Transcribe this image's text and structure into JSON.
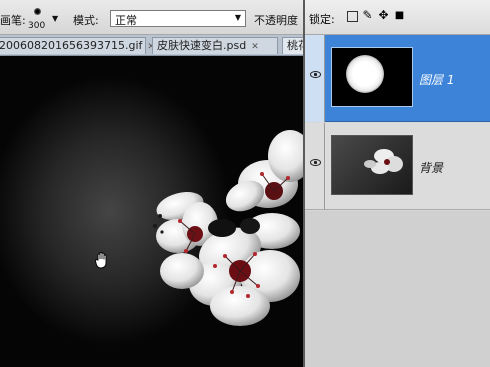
{
  "options_bar": {
    "brush_label": "画笔:",
    "brush_size": "300",
    "mode_label": "模式:",
    "mode_value": "正常",
    "opacity_label": "不透明度"
  },
  "tabs": [
    {
      "label": "20060820165639371​5.gif"
    },
    {
      "label": "皮肤快速变白.psd"
    },
    {
      "label": "桃花"
    }
  ],
  "layers_panel": {
    "lock_label": "锁定:",
    "layers": [
      {
        "name": "图层 1",
        "selected": true,
        "visible": true
      },
      {
        "name": "背景",
        "selected": false,
        "visible": true
      }
    ]
  },
  "colors": {
    "selected_layer": "#3d84d9",
    "panel_bg": "#d7d7d7",
    "canvas_edge": "#050505"
  },
  "icons": [
    "brush-tip-icon",
    "dropdown-arrow-icon",
    "hand-tool-icon",
    "eye-icon",
    "lock-transparent-icon",
    "lock-paint-icon",
    "lock-move-icon",
    "lock-all-icon"
  ]
}
